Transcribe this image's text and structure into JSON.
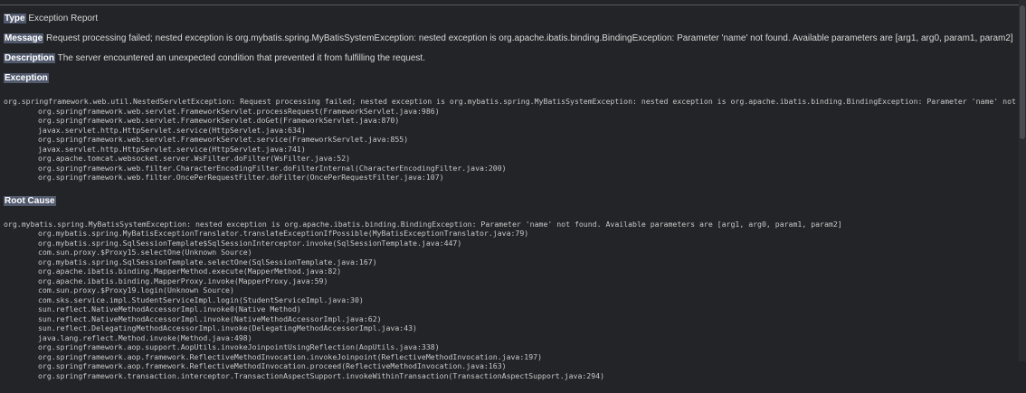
{
  "report": {
    "type_label": "Type",
    "type_value": "Exception Report",
    "message_label": "Message",
    "message_value": "Request processing failed; nested exception is org.mybatis.spring.MyBatisSystemException: nested exception is org.apache.ibatis.binding.BindingException: Parameter 'name' not found. Available parameters are [arg1, arg0, param1, param2]",
    "description_label": "Description",
    "description_value": "The server encountered an unexpected condition that prevented it from fulfilling the request."
  },
  "exception": {
    "heading": "Exception",
    "lines": [
      "org.springframework.web.util.NestedServletException: Request processing failed; nested exception is org.mybatis.spring.MyBatisSystemException: nested exception is org.apache.ibatis.binding.BindingException: Parameter 'name' not found. Av",
      "org.springframework.web.servlet.FrameworkServlet.processRequest(FrameworkServlet.java:986)",
      "org.springframework.web.servlet.FrameworkServlet.doGet(FrameworkServlet.java:870)",
      "javax.servlet.http.HttpServlet.service(HttpServlet.java:634)",
      "org.springframework.web.servlet.FrameworkServlet.service(FrameworkServlet.java:855)",
      "javax.servlet.http.HttpServlet.service(HttpServlet.java:741)",
      "org.apache.tomcat.websocket.server.WsFilter.doFilter(WsFilter.java:52)",
      "org.springframework.web.filter.CharacterEncodingFilter.doFilterInternal(CharacterEncodingFilter.java:200)",
      "org.springframework.web.filter.OncePerRequestFilter.doFilter(OncePerRequestFilter.java:107)"
    ]
  },
  "root_cause": {
    "heading": "Root Cause",
    "lines": [
      "org.mybatis.spring.MyBatisSystemException: nested exception is org.apache.ibatis.binding.BindingException: Parameter 'name' not found. Available parameters are [arg1, arg0, param1, param2]",
      "org.mybatis.spring.MyBatisExceptionTranslator.translateExceptionIfPossible(MyBatisExceptionTranslator.java:79)",
      "org.mybatis.spring.SqlSessionTemplate$SqlSessionInterceptor.invoke(SqlSessionTemplate.java:447)",
      "com.sun.proxy.$Proxy15.selectOne(Unknown Source)",
      "org.mybatis.spring.SqlSessionTemplate.selectOne(SqlSessionTemplate.java:167)",
      "org.apache.ibatis.binding.MapperMethod.execute(MapperMethod.java:82)",
      "org.apache.ibatis.binding.MapperProxy.invoke(MapperProxy.java:59)",
      "com.sun.proxy.$Proxy19.login(Unknown Source)",
      "com.sks.service.impl.StudentServiceImpl.login(StudentServiceImpl.java:30)",
      "sun.reflect.NativeMethodAccessorImpl.invoke0(Native Method)",
      "sun.reflect.NativeMethodAccessorImpl.invoke(NativeMethodAccessorImpl.java:62)",
      "sun.reflect.DelegatingMethodAccessorImpl.invoke(DelegatingMethodAccessorImpl.java:43)",
      "java.lang.reflect.Method.invoke(Method.java:498)",
      "org.springframework.aop.support.AopUtils.invokeJoinpointUsingReflection(AopUtils.java:338)",
      "org.springframework.aop.framework.ReflectiveMethodInvocation.invokeJoinpoint(ReflectiveMethodInvocation.java:197)",
      "org.springframework.aop.framework.ReflectiveMethodInvocation.proceed(ReflectiveMethodInvocation.java:163)",
      "org.springframework.transaction.interceptor.TransactionAspectSupport.invokeWithinTransaction(TransactionAspectSupport.java:294)"
    ]
  }
}
